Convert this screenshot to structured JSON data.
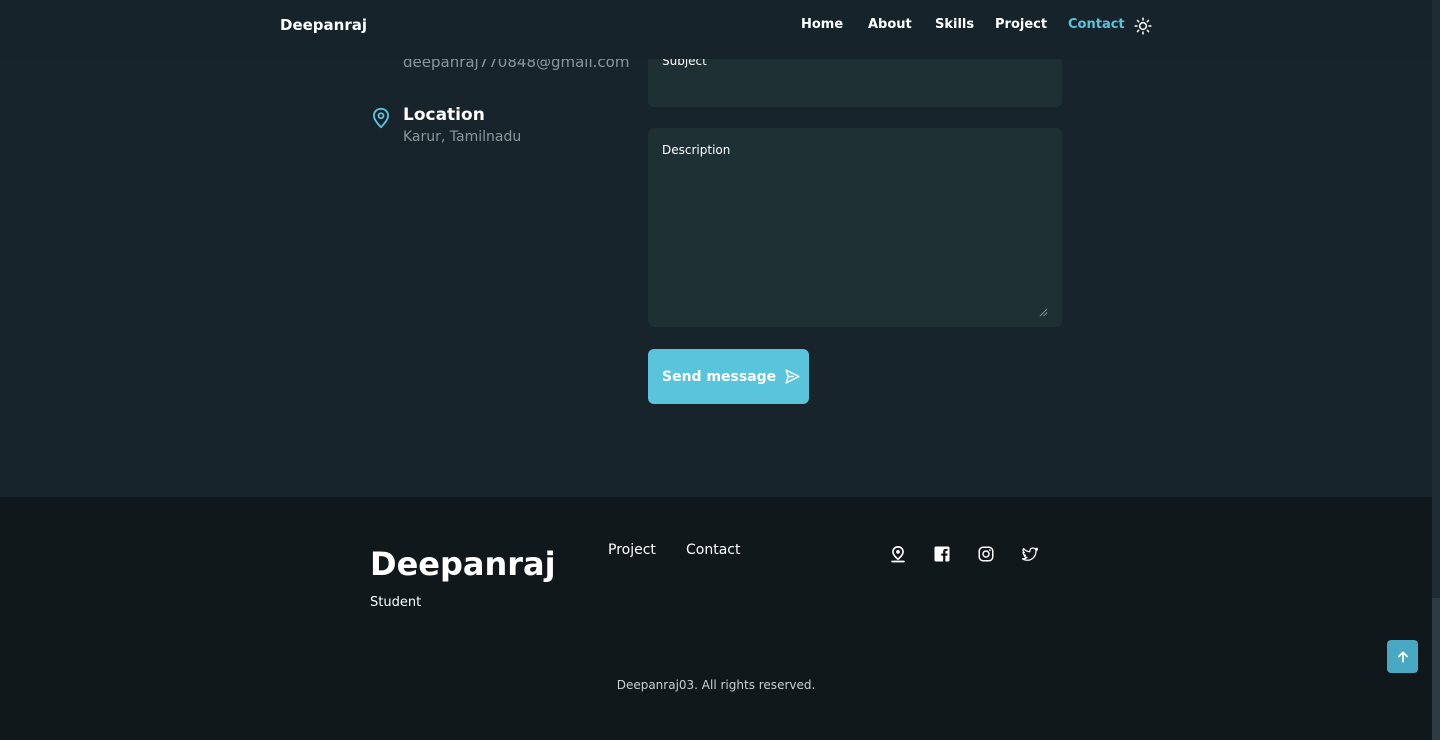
{
  "header": {
    "logo": "Deepanraj",
    "nav": [
      {
        "label": "Home"
      },
      {
        "label": "About"
      },
      {
        "label": "Skills"
      },
      {
        "label": "Project"
      },
      {
        "label": "Contact",
        "active": true
      }
    ],
    "theme_icon": "sun-icon"
  },
  "contact_info": {
    "email": "deepanraj770848@gmail.com",
    "location_title": "Location",
    "location_value": "Karur, Tamilnadu",
    "location_icon": "map-pin-icon"
  },
  "form": {
    "subject_label": "Subject",
    "description_label": "Description",
    "send_label": "Send message",
    "send_icon": "send-icon"
  },
  "footer": {
    "name": "Deepanraj",
    "role": "Student",
    "links": [
      {
        "label": "Project"
      },
      {
        "label": "Contact"
      }
    ],
    "social_icons": [
      "location-pin-icon",
      "facebook-icon",
      "instagram-icon",
      "twitter-icon"
    ],
    "copyright": "Deepanraj03. All rights reserved."
  },
  "colors": {
    "accent": "#5ac4dc",
    "background": "#18242b",
    "footer_background": "#10181c",
    "field_background": "#1f3035"
  }
}
